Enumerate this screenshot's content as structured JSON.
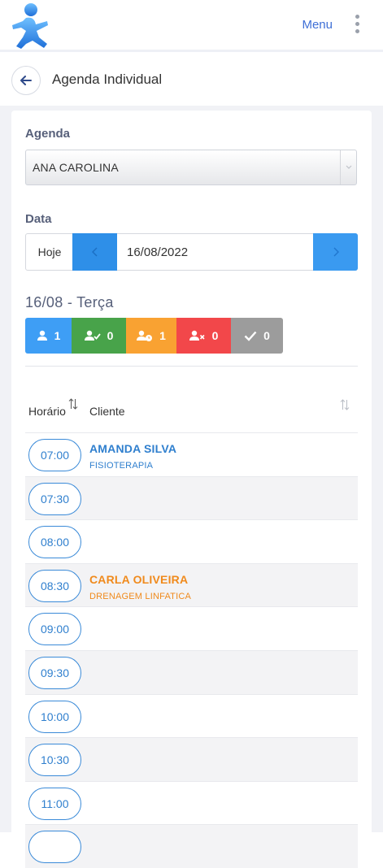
{
  "topbar": {
    "menu_label": "Menu"
  },
  "page_header": {
    "title": "Agenda Individual"
  },
  "form": {
    "agenda_label": "Agenda",
    "agenda_value": "ANA CAROLINA",
    "date_label": "Data",
    "today_label": "Hoje",
    "date_value": "16/08/2022"
  },
  "day": {
    "title": "16/08 - Terça",
    "counters": [
      {
        "icon": "user-icon",
        "count": "1",
        "color": "#3e9ef5"
      },
      {
        "icon": "user-check-icon",
        "count": "0",
        "color": "#48a34a"
      },
      {
        "icon": "user-clock-icon",
        "count": "1",
        "color": "#f9a232"
      },
      {
        "icon": "user-times-icon",
        "count": "0",
        "color": "#f2474a"
      },
      {
        "icon": "check-icon",
        "count": "0",
        "color": "#9c9c9c"
      }
    ]
  },
  "table": {
    "header_time": "Horário",
    "header_client": "Cliente",
    "rows": [
      {
        "time": "07:00",
        "client": "AMANDA SILVA",
        "service": "FISIOTERAPIA",
        "color": "#2f7fce"
      },
      {
        "time": "07:30",
        "client": "",
        "service": ""
      },
      {
        "time": "08:00",
        "client": "",
        "service": ""
      },
      {
        "time": "08:30",
        "client": "CARLA OLIVEIRA",
        "service": "DRENAGEM LINFATICA",
        "color": "#f08a1c"
      },
      {
        "time": "09:00",
        "client": "",
        "service": ""
      },
      {
        "time": "09:30",
        "client": "",
        "service": ""
      },
      {
        "time": "10:00",
        "client": "",
        "service": ""
      },
      {
        "time": "10:30",
        "client": "",
        "service": ""
      },
      {
        "time": "11:00",
        "client": "",
        "service": ""
      }
    ]
  }
}
